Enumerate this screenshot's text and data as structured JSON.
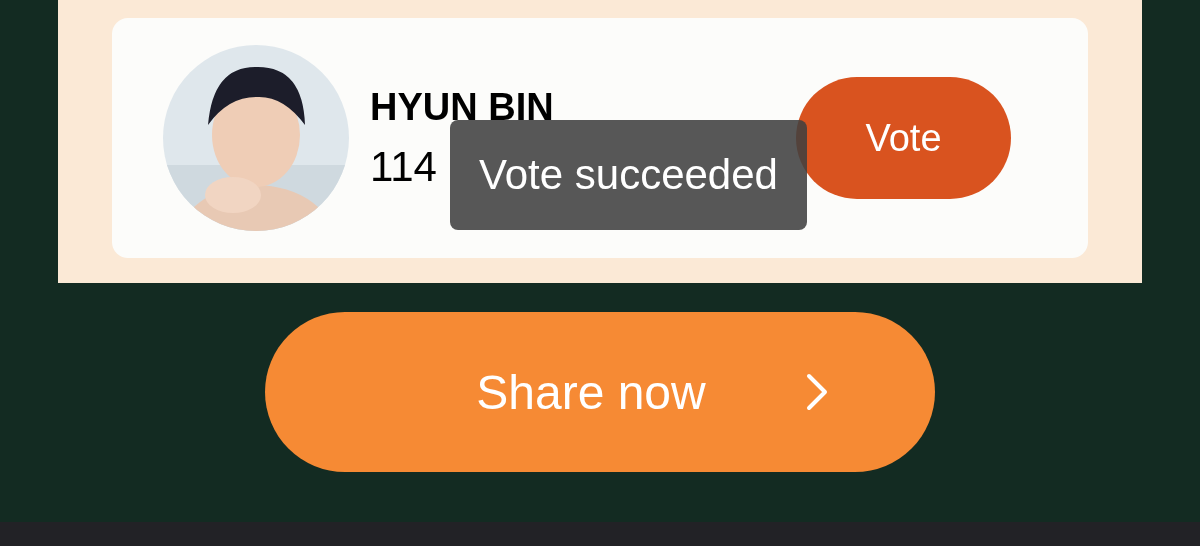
{
  "candidate": {
    "name": "HYUN BIN",
    "votes": "114"
  },
  "vote_button": {
    "label": "Vote"
  },
  "toast": {
    "message": "Vote succeeded"
  },
  "share_button": {
    "label": "Share now"
  }
}
